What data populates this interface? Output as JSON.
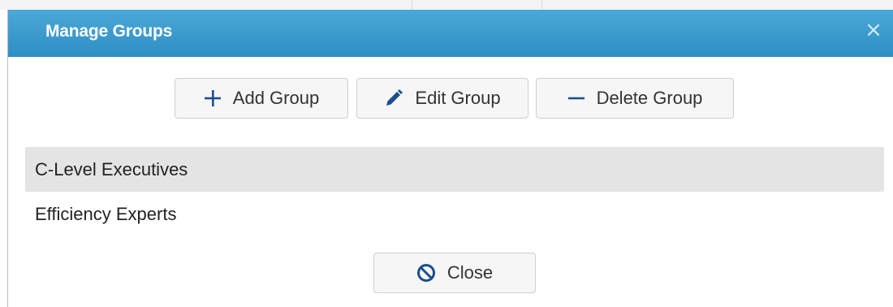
{
  "dialog": {
    "title": "Manage Groups",
    "close_glyph": "×"
  },
  "toolbar": {
    "add_label": "Add Group",
    "edit_label": "Edit Group",
    "delete_label": "Delete Group"
  },
  "groups": [
    {
      "name": "C-Level Executives",
      "selected": true
    },
    {
      "name": "Efficiency Experts",
      "selected": false
    }
  ],
  "footer": {
    "close_label": "Close"
  },
  "icons": {
    "add": "plus-icon",
    "edit": "pencil-icon",
    "delete": "minus-icon",
    "close": "ban-icon",
    "dismiss": "close-icon"
  },
  "colors": {
    "titlebar": "#3a9bd0",
    "selected_row": "#e4e4e4",
    "icon_blue": "#1a4f8b"
  }
}
